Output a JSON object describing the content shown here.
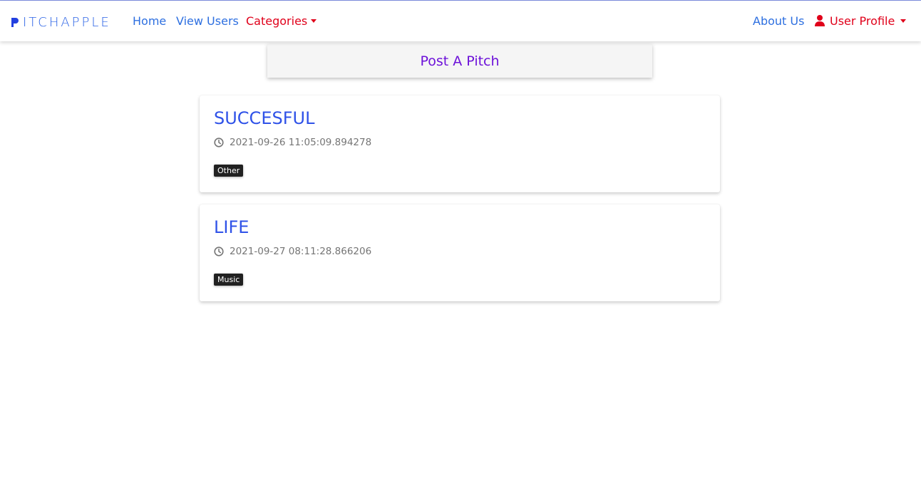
{
  "navbar": {
    "brand": "ITCHAPPLE",
    "links": [
      "Home",
      "View Users",
      "Categories",
      "About Us",
      "User Profile"
    ]
  },
  "post_pitch": "Post A Pitch",
  "pitches": [
    {
      "title": "SUCCESFUL",
      "time": "2021-09-26 11:05:09.894278",
      "category": "Other"
    },
    {
      "title": "LIFE",
      "time": "2021-09-27 08:11:28.866206",
      "category": "Music"
    }
  ],
  "colors": {
    "link_blue": "#2d6fe0",
    "link_red": "#e0001a",
    "title_blue": "#2f52e8",
    "post_purple": "#6d12d9"
  }
}
